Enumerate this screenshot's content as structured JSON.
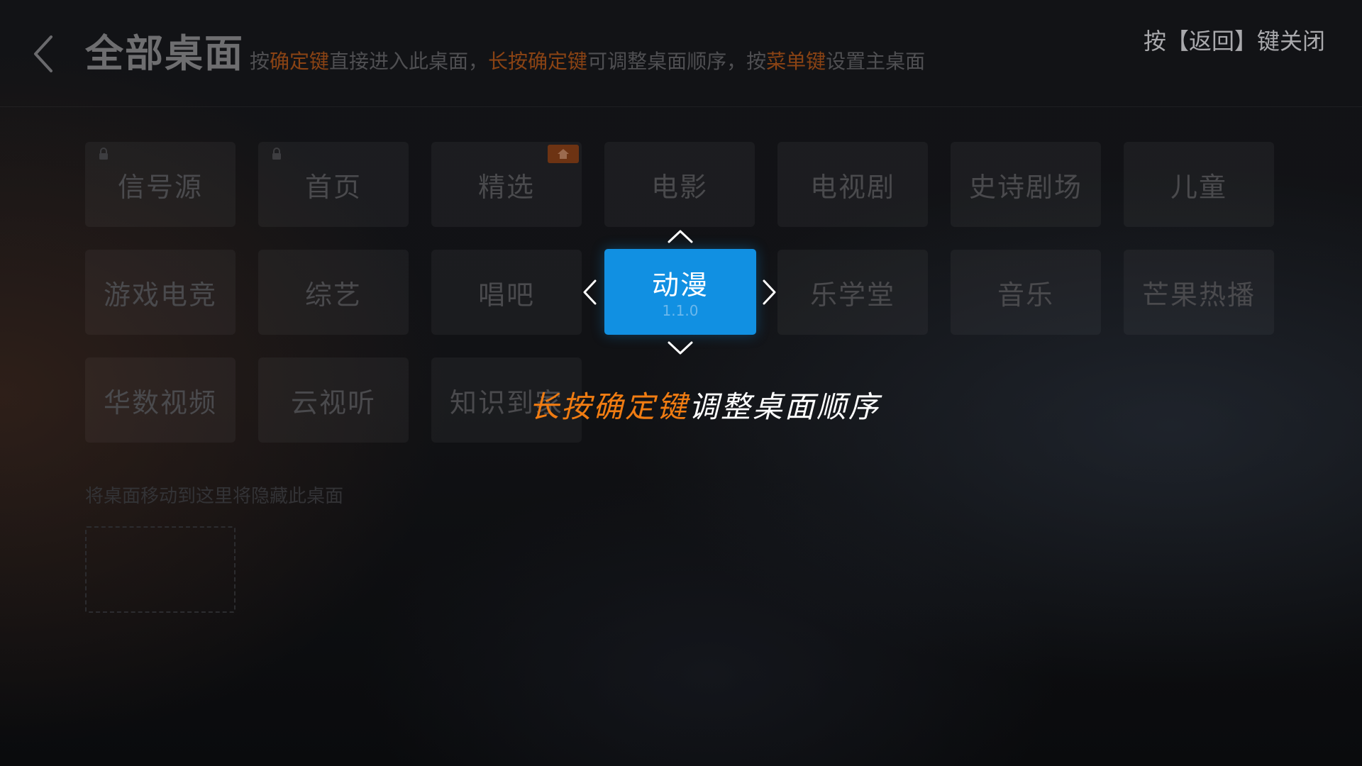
{
  "header": {
    "title": "全部桌面",
    "hint": {
      "p1": "按",
      "h1": "确定键",
      "p2": "直接进入此桌面，",
      "h2": "长按确定键",
      "p3": "可调整桌面顺序，按",
      "h3": "菜单键",
      "p4": "设置主桌面"
    },
    "close_hint": "按【返回】键关闭"
  },
  "tiles": [
    {
      "label": "信号源",
      "locked": true
    },
    {
      "label": "首页",
      "locked": true
    },
    {
      "label": "精选",
      "home": true
    },
    {
      "label": "电影"
    },
    {
      "label": "电视剧"
    },
    {
      "label": "史诗剧场"
    },
    {
      "label": "儿童"
    },
    {
      "label": "游戏电竞"
    },
    {
      "label": "综艺"
    },
    {
      "label": "唱吧"
    },
    {
      "label": "乐学堂"
    },
    {
      "label": "音乐"
    },
    {
      "label": "芒果热播"
    },
    {
      "label": "华数视频"
    },
    {
      "label": "云视听"
    },
    {
      "label": "知识到家"
    }
  ],
  "active_tile": {
    "label": "动漫",
    "version": "1.1.0"
  },
  "guide": {
    "highlight": "长按确定键",
    "rest": "调整桌面顺序"
  },
  "hide_zone": {
    "label": "将桌面移动到这里将隐藏此桌面"
  },
  "colors": {
    "accent": "#1190e2",
    "highlight": "#f07c12",
    "hint_highlight": "#8a4314"
  }
}
